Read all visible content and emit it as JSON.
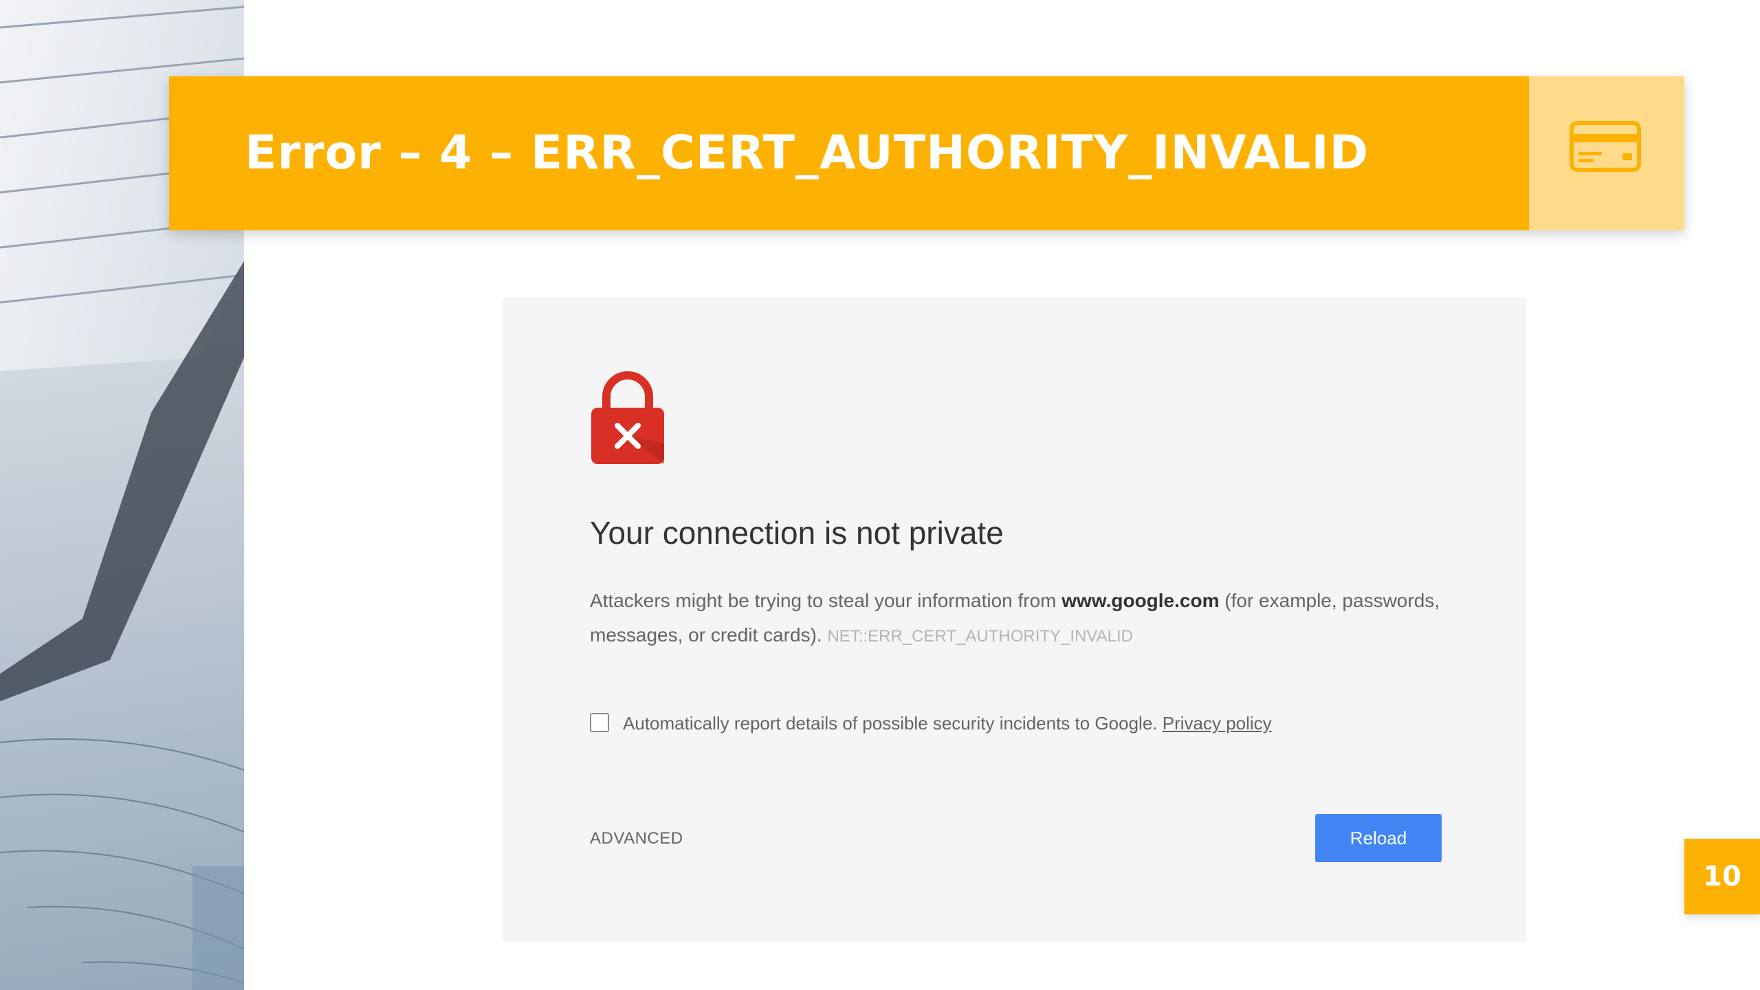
{
  "slide": {
    "title": "Error – 4 – ERR_CERT_AUTHORITY_INVALID",
    "page_number": "10",
    "accent_color": "#FDB103",
    "side_icon": "credit-card-icon"
  },
  "error_page": {
    "icon": "lock-error-icon",
    "icon_color": "#D93025",
    "headline": "Your connection is not private",
    "desc_prefix": "Attackers might be trying to steal your information from ",
    "desc_domain": "www.google.com",
    "desc_suffix": " (for example, passwords, messages, or credit cards). ",
    "error_code": "NET::ERR_CERT_AUTHORITY_INVALID",
    "report_checkbox_checked": false,
    "report_text": "Automatically report details of possible security incidents to Google. ",
    "privacy_link": "Privacy policy",
    "advanced_label": "ADVANCED",
    "reload_label": "Reload",
    "reload_color": "#4286F5"
  }
}
